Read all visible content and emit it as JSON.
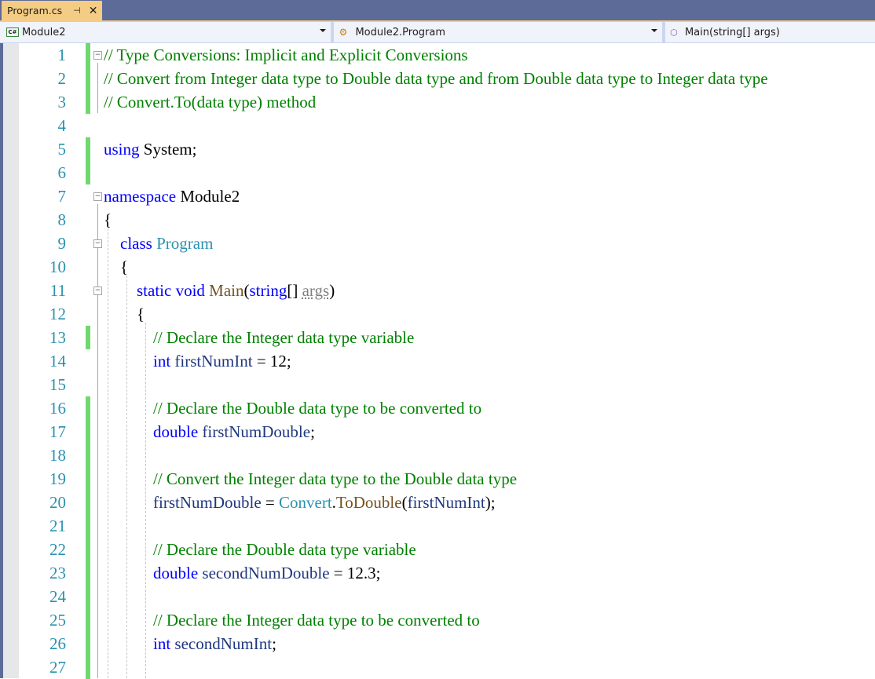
{
  "tab": {
    "title": "Program.cs",
    "pin_icon": "pin-icon",
    "close_icon": "close-icon",
    "pin_glyph": "⊣",
    "close_glyph": "✕"
  },
  "nav": {
    "project": {
      "icon_text": "C#",
      "label": "Module2"
    },
    "type": {
      "label": "Module2.Program"
    },
    "member": {
      "label": "Main(string[] args)"
    }
  },
  "colors": {
    "tab_active": "#f5cc84",
    "chrome": "#5d6b99",
    "line_number": "#2b91af",
    "change_bar": "#6fd86f",
    "keyword": "#0000ff",
    "comment": "#008000",
    "type": "#2b91af",
    "method": "#74531f",
    "identifier": "#1f377f"
  },
  "lines": [
    {
      "n": "1",
      "changed": true,
      "fold": "−",
      "tokens": [
        [
          "cm",
          "// Type Conversions: Implicit and Explicit Conversions"
        ]
      ]
    },
    {
      "n": "2",
      "changed": true,
      "tokens": [
        [
          "cm",
          "// Convert from Integer data type to Double data type and from Double data type to Integer data type"
        ]
      ]
    },
    {
      "n": "3",
      "changed": true,
      "tokens": [
        [
          "cm",
          "// Convert.To(data type) method"
        ]
      ]
    },
    {
      "n": "4",
      "changed": false,
      "tokens": []
    },
    {
      "n": "5",
      "changed": true,
      "tokens": [
        [
          "kw",
          "using"
        ],
        [
          "pn",
          " System;"
        ]
      ]
    },
    {
      "n": "6",
      "changed": true,
      "tokens": []
    },
    {
      "n": "7",
      "changed": false,
      "fold": "−",
      "tokens": [
        [
          "kw",
          "namespace"
        ],
        [
          "pn",
          " Module2"
        ]
      ]
    },
    {
      "n": "8",
      "changed": false,
      "tokens": [
        [
          "pn",
          "{"
        ]
      ]
    },
    {
      "n": "9",
      "changed": false,
      "fold": "−",
      "tokens": [
        [
          "pn",
          "    "
        ],
        [
          "kw",
          "class"
        ],
        [
          "pn",
          " "
        ],
        [
          "ty",
          "Program"
        ]
      ]
    },
    {
      "n": "10",
      "changed": false,
      "tokens": [
        [
          "pn",
          "    {"
        ]
      ]
    },
    {
      "n": "11",
      "changed": false,
      "fold": "−",
      "tokens": [
        [
          "pn",
          "        "
        ],
        [
          "kw",
          "static"
        ],
        [
          "pn",
          " "
        ],
        [
          "kw",
          "void"
        ],
        [
          "pn",
          " "
        ],
        [
          "mt",
          "Main"
        ],
        [
          "pn",
          "("
        ],
        [
          "kw",
          "string"
        ],
        [
          "pn",
          "[] "
        ],
        [
          "pa",
          "args"
        ],
        [
          "pn",
          ")"
        ]
      ]
    },
    {
      "n": "12",
      "changed": false,
      "tokens": [
        [
          "pn",
          "        {"
        ]
      ]
    },
    {
      "n": "13",
      "changed": true,
      "tokens": [
        [
          "pn",
          "            "
        ],
        [
          "cm",
          "// Declare the Integer data type variable"
        ]
      ]
    },
    {
      "n": "14",
      "changed": false,
      "tokens": [
        [
          "pn",
          "            "
        ],
        [
          "kw",
          "int"
        ],
        [
          "pn",
          " "
        ],
        [
          "id",
          "firstNumInt"
        ],
        [
          "pn",
          " = 12;"
        ]
      ]
    },
    {
      "n": "15",
      "changed": false,
      "tokens": []
    },
    {
      "n": "16",
      "changed": true,
      "tokens": [
        [
          "pn",
          "            "
        ],
        [
          "cm",
          "// Declare the Double data type to be converted to"
        ]
      ]
    },
    {
      "n": "17",
      "changed": true,
      "tokens": [
        [
          "pn",
          "            "
        ],
        [
          "kw",
          "double"
        ],
        [
          "pn",
          " "
        ],
        [
          "id",
          "firstNumDouble"
        ],
        [
          "pn",
          ";"
        ]
      ]
    },
    {
      "n": "18",
      "changed": true,
      "tokens": []
    },
    {
      "n": "19",
      "changed": true,
      "tokens": [
        [
          "pn",
          "            "
        ],
        [
          "cm",
          "// Convert the Integer data type to the Double data type"
        ]
      ]
    },
    {
      "n": "20",
      "changed": true,
      "tokens": [
        [
          "pn",
          "            "
        ],
        [
          "id",
          "firstNumDouble"
        ],
        [
          "pn",
          " = "
        ],
        [
          "ty",
          "Convert"
        ],
        [
          "pn",
          "."
        ],
        [
          "mt",
          "ToDouble"
        ],
        [
          "pn",
          "("
        ],
        [
          "id",
          "firstNumInt"
        ],
        [
          "pn",
          ");"
        ]
      ]
    },
    {
      "n": "21",
      "changed": true,
      "tokens": []
    },
    {
      "n": "22",
      "changed": true,
      "tokens": [
        [
          "pn",
          "            "
        ],
        [
          "cm",
          "// Declare the Double data type variable"
        ]
      ]
    },
    {
      "n": "23",
      "changed": true,
      "tokens": [
        [
          "pn",
          "            "
        ],
        [
          "kw",
          "double"
        ],
        [
          "pn",
          " "
        ],
        [
          "id",
          "secondNumDouble"
        ],
        [
          "pn",
          " = 12.3;"
        ]
      ]
    },
    {
      "n": "24",
      "changed": true,
      "tokens": []
    },
    {
      "n": "25",
      "changed": true,
      "tokens": [
        [
          "pn",
          "            "
        ],
        [
          "cm",
          "// Declare the Integer data type to be converted to"
        ]
      ]
    },
    {
      "n": "26",
      "changed": true,
      "tokens": [
        [
          "pn",
          "            "
        ],
        [
          "kw",
          "int"
        ],
        [
          "pn",
          " "
        ],
        [
          "id",
          "secondNumInt"
        ],
        [
          "pn",
          ";"
        ]
      ]
    },
    {
      "n": "27",
      "changed": true,
      "tokens": []
    }
  ]
}
